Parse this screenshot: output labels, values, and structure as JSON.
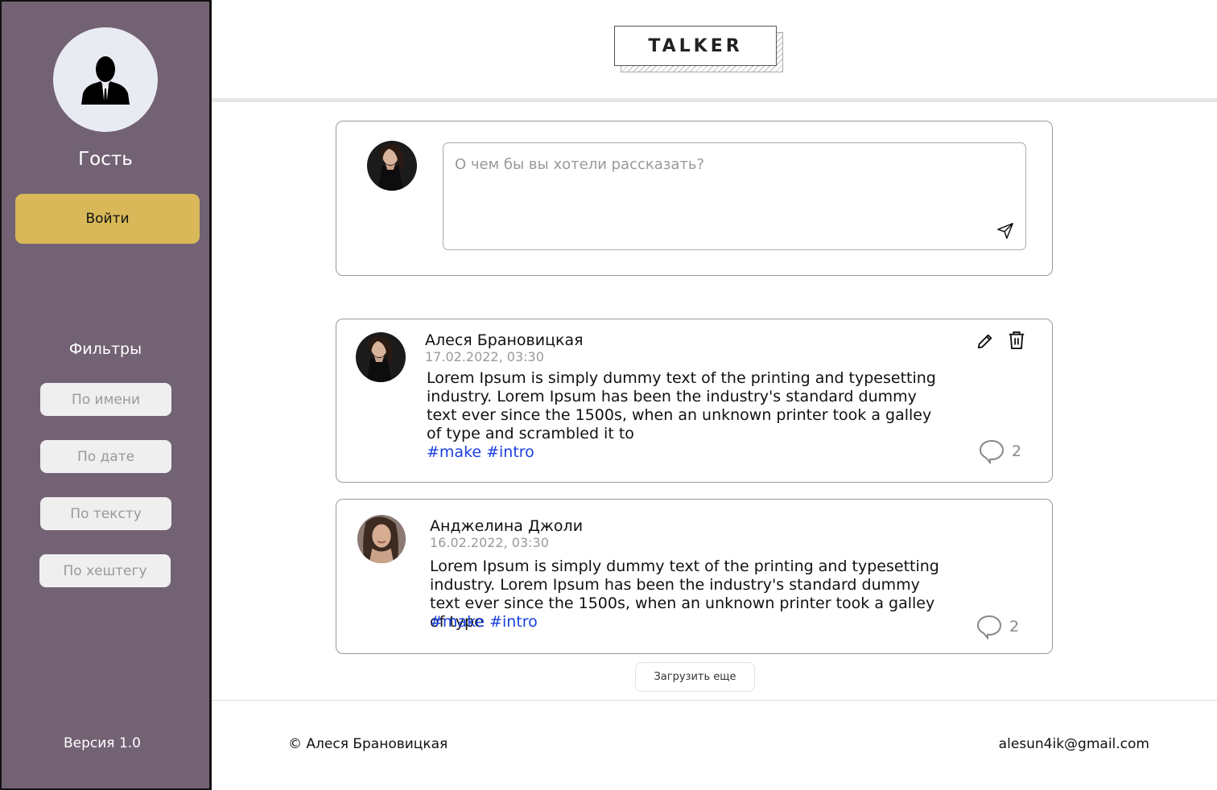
{
  "sidebar": {
    "guest_name": "Гость",
    "login_label": "Войти",
    "filters_title": "Фильтры",
    "filters": [
      {
        "label": "По имени"
      },
      {
        "label": "По дате"
      },
      {
        "label": "По тексту"
      },
      {
        "label": "По хештегу"
      }
    ],
    "version": "Версия 1.0",
    "background_color": "#736274",
    "login_color": "#d8b858"
  },
  "header": {
    "logo": "TALKER"
  },
  "compose": {
    "placeholder": "О чем бы вы хотели рассказать?",
    "avatar_icon": "user-photo",
    "send_icon": "send-icon"
  },
  "posts": [
    {
      "author": "Алеся Брановицкая",
      "date": "17.02.2022, 03:30",
      "text": "Lorem Ipsum is simply dummy text of the printing and typesetting industry. Lorem Ipsum has been the industry's standard dummy text ever since the 1500s, when an unknown printer took a galley of type and scrambled it to",
      "tags": [
        "#make",
        "#intro"
      ],
      "comments": "2",
      "editable": true
    },
    {
      "author": "Анджелина Джоли",
      "date": "16.02.2022, 03:30",
      "text": "Lorem Ipsum is simply dummy text of the printing and typesetting industry. Lorem Ipsum has been the industry's standard dummy text ever since the 1500s, when an unknown printer took a galley of type",
      "tags": [
        "#make",
        "#intro"
      ],
      "comments": "2",
      "editable": false
    }
  ],
  "load_more_label": "Загрузить еще",
  "footer": {
    "copyright": "© Алеся Брановицкая",
    "email": "alesun4ik@gmail.com"
  },
  "colors": {
    "hashtag": "#1a3fe0",
    "muted": "#999999"
  }
}
